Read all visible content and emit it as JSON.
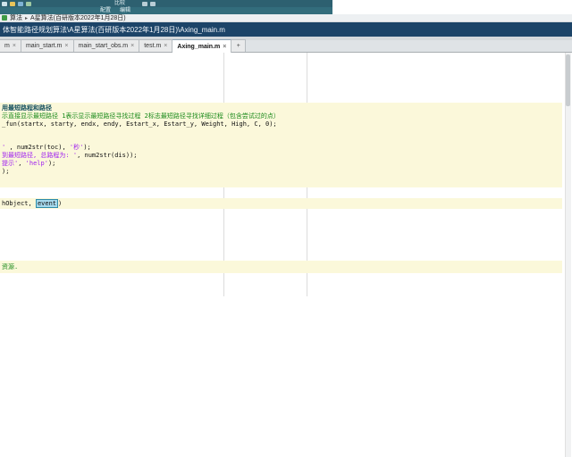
{
  "toolbar": {
    "row1": {
      "compare_label": "比较"
    },
    "row2": {
      "config_label": "配置",
      "edit_label": "编辑"
    }
  },
  "breadcrumb": {
    "root_label": "算法",
    "separator": "▸",
    "current_folder": "A星算法(百研版本2022年1月28日)"
  },
  "pathbar": {
    "path": "体智能路径规划算法\\A星算法(百研版本2022年1月28日)\\Axing_main.m"
  },
  "tabbar": {
    "close_glyph": "×",
    "new_tab_glyph": "+",
    "tabs": [
      {
        "label": "m"
      },
      {
        "label": "main_start.m"
      },
      {
        "label": "main_start_obs.m"
      },
      {
        "label": "test.m"
      },
      {
        "label": "Axing_main.m"
      }
    ]
  },
  "code": {
    "section_title": "用最短路程和路径",
    "comment_line": "示直接显示最短路径  1表示显示最短路径寻找过程  2标志最短路径寻找详细过程（包含尝试过的点）",
    "call_line": "_fun(startx, starty, endx, endy, Estart_x, Estart_y, Weight, High, C, 0);",
    "toc_line": {
      "s1": "' ",
      "s2": ", num2str(toc), ",
      "s3": "'秒'",
      "s4": ");"
    },
    "dis_line": {
      "s1": "到最短路径, 总路程为: '",
      "s2": ", num2str(dis));"
    },
    "help_line": {
      "s1": "提示'",
      "s2": ", ",
      "s3": "'help'",
      "s4": ");"
    },
    "close_line": ");",
    "callback_line": {
      "s1": "hObject, ",
      "s2": "event",
      "s3": ")"
    },
    "bottom_comment": "资源."
  },
  "colors": {
    "section_bg": "#fbf8da",
    "string": "#A020F0",
    "comment": "#1a8a1a",
    "highlight": "#a6d9ec",
    "pathbar_bg": "#1c4468",
    "toolbar_bg": "#2d6070"
  }
}
